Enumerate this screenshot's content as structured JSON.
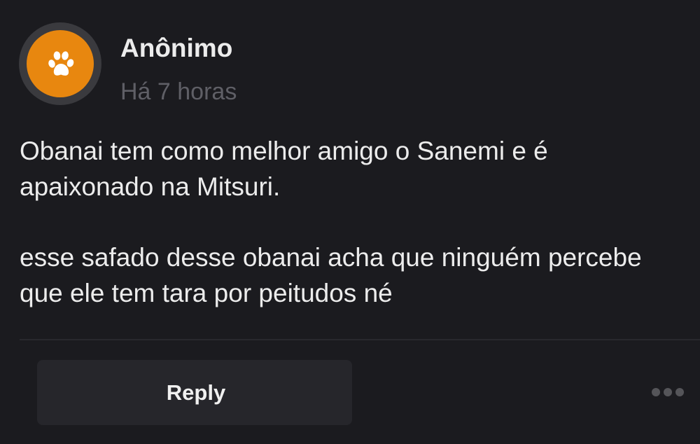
{
  "comment": {
    "author": "Anônimo",
    "timestamp": "Há 7 horas",
    "avatar_icon": "paw-icon",
    "avatar_color": "#e8870f",
    "paragraphs": [
      "Obanai tem como melhor amigo o Sanemi e é apaixonado na Mitsuri.",
      "esse safado desse obanai acha que ninguém percebe que ele tem tara por peitudos né"
    ]
  },
  "actions": {
    "reply_label": "Reply",
    "more_icon": "more-dots-icon"
  }
}
